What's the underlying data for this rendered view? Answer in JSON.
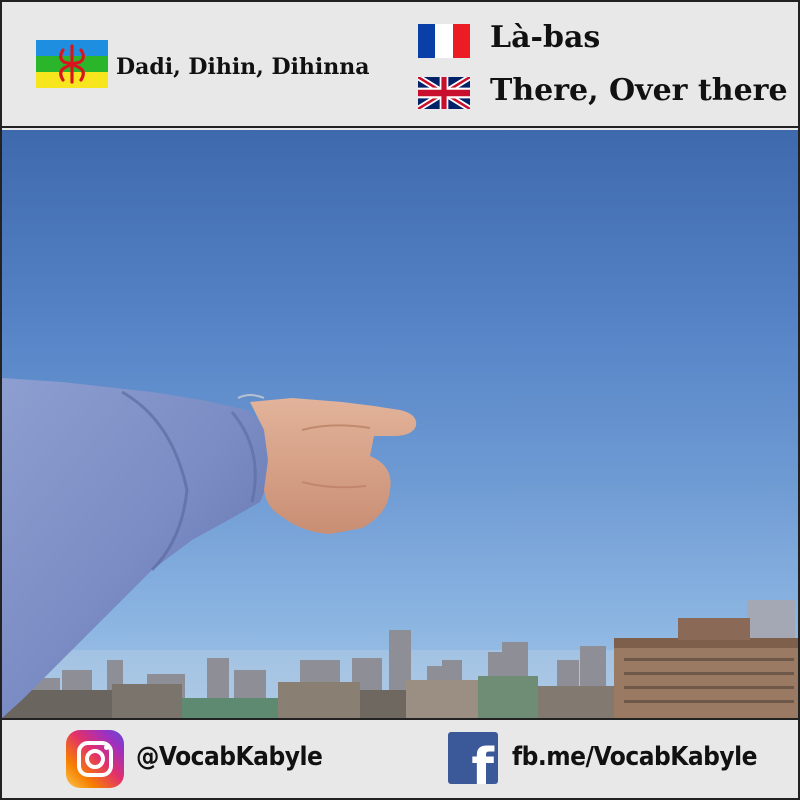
{
  "header": {
    "kabyle": {
      "flag_icon": "amazigh-flag-icon",
      "text": "Dadi, Dihin, Dihinna"
    },
    "french": {
      "flag_icon": "france-flag-icon",
      "text": "Là-bas"
    },
    "english": {
      "flag_icon": "uk-flag-icon",
      "text": "There, Over there"
    }
  },
  "photo": {
    "subject": "hand-pointing-at-skyline-photo"
  },
  "footer": {
    "instagram": {
      "icon": "instagram-icon",
      "handle": "@VocabKabyle"
    },
    "facebook": {
      "icon": "facebook-icon",
      "link": "fb.me/VocabKabyle"
    }
  },
  "colors": {
    "background": "#e8e8e8",
    "border": "#222222",
    "sky": "#5b88c8",
    "facebook_blue": "#3b5998"
  }
}
